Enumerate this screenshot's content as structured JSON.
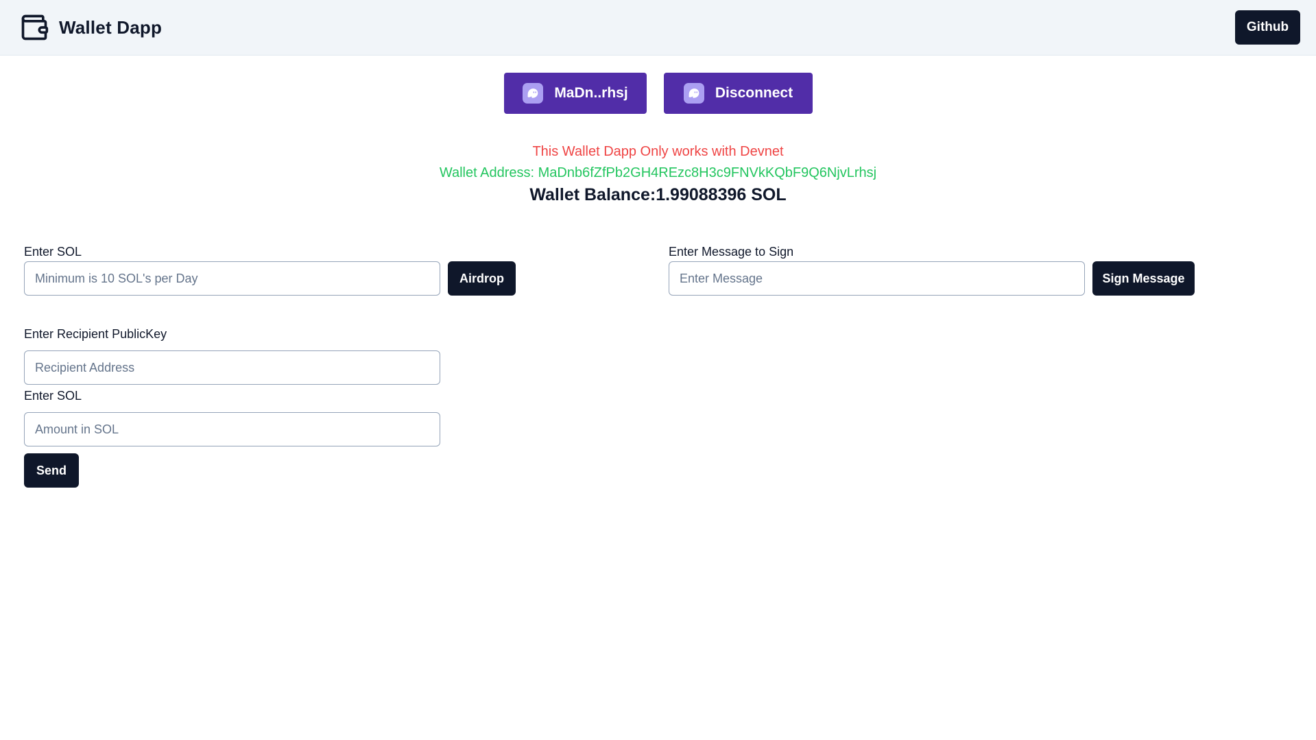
{
  "header": {
    "app_title": "Wallet Dapp",
    "logo_icon": "wallet-icon",
    "github_label": "Github"
  },
  "wallet": {
    "account_label": "MaDn..rhsj",
    "disconnect_label": "Disconnect",
    "button_icon": "phantom-ghost-icon"
  },
  "info": {
    "devnet_notice": "This Wallet Dapp Only works with Devnet",
    "address_text": "Wallet Address: MaDnb6fZfPb2GH4REzc8H3c9FNVkKQbF9Q6NjvLrhsj",
    "balance_text": "Wallet Balance:1.99088396 SOL"
  },
  "airdrop": {
    "label": "Enter SOL",
    "value": "",
    "placeholder": "Minimum is 10 SOL's per Day",
    "button_label": "Airdrop"
  },
  "sign": {
    "label": "Enter Message to Sign",
    "value": "",
    "placeholder": "Enter Message",
    "button_label": "Sign Message"
  },
  "send": {
    "recipient_label": "Enter Recipient PublicKey",
    "recipient_value": "",
    "recipient_placeholder": "Recipient Address",
    "amount_label": "Enter SOL",
    "amount_value": "",
    "amount_placeholder": "Amount in SOL",
    "button_label": "Send"
  },
  "colors": {
    "header_bg": "#f1f5f9",
    "wallet_button": "#512da8",
    "dark_button": "#0f172a",
    "notice_red": "#ef4444",
    "address_green": "#22c55e"
  }
}
